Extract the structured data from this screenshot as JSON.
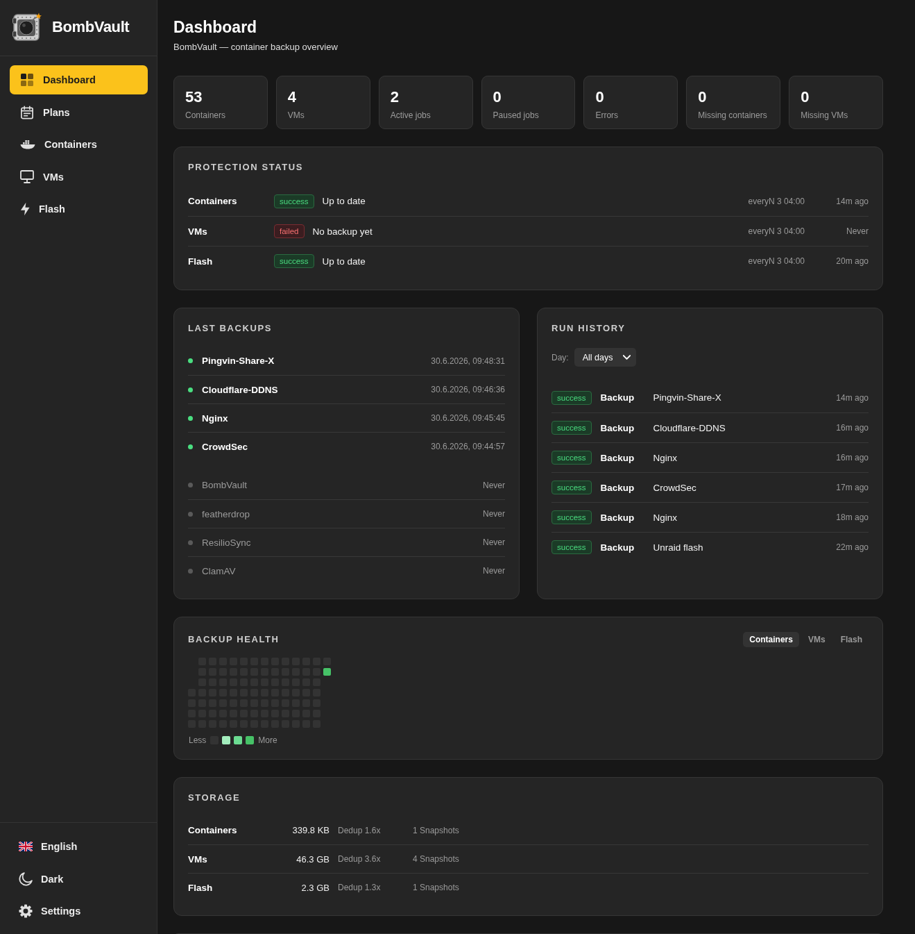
{
  "sidebar": {
    "brand": "BombVault",
    "nav": [
      {
        "label": "Dashboard",
        "selected": true
      },
      {
        "label": "Plans",
        "selected": false
      },
      {
        "label": "Containers",
        "selected": false
      },
      {
        "label": "VMs",
        "selected": false
      },
      {
        "label": "Flash",
        "selected": false
      }
    ],
    "footer": [
      {
        "label": "English"
      },
      {
        "label": "Dark"
      },
      {
        "label": "Settings"
      }
    ]
  },
  "header": {
    "title": "Dashboard",
    "subtitle": "BombVault — container backup overview"
  },
  "stats": [
    {
      "value": "53",
      "label": "Containers"
    },
    {
      "value": "4",
      "label": "VMs"
    },
    {
      "value": "2",
      "label": "Active jobs"
    },
    {
      "value": "0",
      "label": "Paused jobs"
    },
    {
      "value": "0",
      "label": "Errors"
    },
    {
      "value": "0",
      "label": "Missing containers"
    },
    {
      "value": "0",
      "label": "Missing VMs"
    }
  ],
  "protection_status": {
    "title": "PROTECTION STATUS",
    "rows": [
      {
        "name": "Containers",
        "badge": "success",
        "failed": false,
        "message": "Up to date",
        "schedule": "everyN 3 04:00",
        "last_run": "14m ago"
      },
      {
        "name": "VMs",
        "badge": "failed",
        "failed": true,
        "message": "No backup yet",
        "schedule": "everyN 3 04:00",
        "last_run": "Never"
      },
      {
        "name": "Flash",
        "badge": "success",
        "failed": false,
        "message": "Up to date",
        "schedule": "everyN 3 04:00",
        "last_run": "20m ago"
      }
    ]
  },
  "last_backups": {
    "title": "LAST BACKUPS",
    "groups": [
      {
        "items": [
          {
            "name": "Pingvin-Share-X",
            "time": "30.6.2026, 09:48:31",
            "backed_up": true
          },
          {
            "name": "Cloudflare-DDNS",
            "time": "30.6.2026, 09:46:36",
            "backed_up": true
          },
          {
            "name": "Nginx",
            "time": "30.6.2026, 09:45:45",
            "backed_up": true
          },
          {
            "name": "CrowdSec",
            "time": "30.6.2026, 09:44:57",
            "backed_up": true
          }
        ]
      },
      {
        "items": [
          {
            "name": "BombVault",
            "time": "Never",
            "backed_up": false
          },
          {
            "name": "featherdrop",
            "time": "Never",
            "backed_up": false
          },
          {
            "name": "ResilioSync",
            "time": "Never",
            "backed_up": false
          },
          {
            "name": "ClamAV",
            "time": "Never",
            "backed_up": false
          }
        ]
      }
    ]
  },
  "run_history": {
    "title": "RUN HISTORY",
    "filter": {
      "label": "Day:",
      "value": "All days"
    },
    "runs": [
      {
        "badge": "success",
        "failed": false,
        "type": "Backup",
        "target": "Pingvin-Share-X",
        "time": "14m ago"
      },
      {
        "badge": "success",
        "failed": false,
        "type": "Backup",
        "target": "Cloudflare-DDNS",
        "time": "16m ago"
      },
      {
        "badge": "success",
        "failed": false,
        "type": "Backup",
        "target": "Nginx",
        "time": "16m ago"
      },
      {
        "badge": "success",
        "failed": false,
        "type": "Backup",
        "target": "CrowdSec",
        "time": "17m ago"
      },
      {
        "badge": "success",
        "failed": false,
        "type": "Backup",
        "target": "Nginx",
        "time": "18m ago"
      },
      {
        "badge": "success",
        "failed": false,
        "type": "Backup",
        "target": "Unraid flash",
        "time": "22m ago"
      }
    ]
  },
  "backup_health": {
    "title": "BACKUP HEALTH",
    "tabs": [
      {
        "label": "Containers",
        "selected": true
      },
      {
        "label": "VMs",
        "selected": false
      },
      {
        "label": "Flash",
        "selected": false
      }
    ],
    "weeks": [
      {
        "days": [
          {
            "color": "#333333"
          },
          {
            "color": "#333333"
          },
          {
            "color": "#333333"
          },
          {
            "color": "#333333"
          }
        ]
      },
      {
        "days": [
          {
            "color": "#333333"
          },
          {
            "color": "#333333"
          },
          {
            "color": "#333333"
          },
          {
            "color": "#333333"
          },
          {
            "color": "#333333"
          },
          {
            "color": "#333333"
          },
          {
            "color": "#333333"
          }
        ]
      },
      {
        "days": [
          {
            "color": "#333333"
          },
          {
            "color": "#333333"
          },
          {
            "color": "#333333"
          },
          {
            "color": "#333333"
          },
          {
            "color": "#333333"
          },
          {
            "color": "#333333"
          },
          {
            "color": "#333333"
          }
        ]
      },
      {
        "days": [
          {
            "color": "#333333"
          },
          {
            "color": "#333333"
          },
          {
            "color": "#333333"
          },
          {
            "color": "#333333"
          },
          {
            "color": "#333333"
          },
          {
            "color": "#333333"
          },
          {
            "color": "#333333"
          }
        ]
      },
      {
        "days": [
          {
            "color": "#333333"
          },
          {
            "color": "#333333"
          },
          {
            "color": "#333333"
          },
          {
            "color": "#333333"
          },
          {
            "color": "#333333"
          },
          {
            "color": "#333333"
          },
          {
            "color": "#333333"
          }
        ]
      },
      {
        "days": [
          {
            "color": "#333333"
          },
          {
            "color": "#333333"
          },
          {
            "color": "#333333"
          },
          {
            "color": "#333333"
          },
          {
            "color": "#333333"
          },
          {
            "color": "#333333"
          },
          {
            "color": "#333333"
          }
        ]
      },
      {
        "days": [
          {
            "color": "#333333"
          },
          {
            "color": "#333333"
          },
          {
            "color": "#333333"
          },
          {
            "color": "#333333"
          },
          {
            "color": "#333333"
          },
          {
            "color": "#333333"
          },
          {
            "color": "#333333"
          }
        ]
      },
      {
        "days": [
          {
            "color": "#333333"
          },
          {
            "color": "#333333"
          },
          {
            "color": "#333333"
          },
          {
            "color": "#333333"
          },
          {
            "color": "#333333"
          },
          {
            "color": "#333333"
          },
          {
            "color": "#333333"
          }
        ]
      },
      {
        "days": [
          {
            "color": "#333333"
          },
          {
            "color": "#333333"
          },
          {
            "color": "#333333"
          },
          {
            "color": "#333333"
          },
          {
            "color": "#333333"
          },
          {
            "color": "#333333"
          },
          {
            "color": "#333333"
          }
        ]
      },
      {
        "days": [
          {
            "color": "#333333"
          },
          {
            "color": "#333333"
          },
          {
            "color": "#333333"
          },
          {
            "color": "#333333"
          },
          {
            "color": "#333333"
          },
          {
            "color": "#333333"
          },
          {
            "color": "#333333"
          }
        ]
      },
      {
        "days": [
          {
            "color": "#333333"
          },
          {
            "color": "#333333"
          },
          {
            "color": "#333333"
          },
          {
            "color": "#333333"
          },
          {
            "color": "#333333"
          },
          {
            "color": "#333333"
          },
          {
            "color": "#333333"
          }
        ]
      },
      {
        "days": [
          {
            "color": "#333333"
          },
          {
            "color": "#333333"
          },
          {
            "color": "#333333"
          },
          {
            "color": "#333333"
          },
          {
            "color": "#333333"
          },
          {
            "color": "#333333"
          },
          {
            "color": "#333333"
          }
        ]
      },
      {
        "days": [
          {
            "color": "#333333"
          },
          {
            "color": "#333333"
          },
          {
            "color": "#333333"
          },
          {
            "color": "#333333"
          },
          {
            "color": "#333333"
          },
          {
            "color": "#333333"
          },
          {
            "color": "#333333"
          }
        ]
      },
      {
        "days": [
          {
            "color": "#333333"
          },
          {
            "color": "#46c267"
          }
        ]
      }
    ],
    "legend": {
      "less": "Less",
      "more": "More",
      "swatches": [
        {
          "color": "#333333"
        },
        {
          "color": "#a3edbd"
        },
        {
          "color": "#6bdb91"
        },
        {
          "color": "#46c267"
        }
      ]
    }
  },
  "storage": {
    "title": "STORAGE",
    "rows": [
      {
        "name": "Containers",
        "size": "339.8 KB",
        "dedup": "Dedup 1.6x",
        "snapshots": "1 Snapshots"
      },
      {
        "name": "VMs",
        "size": "46.3 GB",
        "dedup": "Dedup 3.6x",
        "snapshots": "4 Snapshots"
      },
      {
        "name": "Flash",
        "size": "2.3 GB",
        "dedup": "Dedup 1.3x",
        "snapshots": "1 Snapshots"
      }
    ]
  }
}
